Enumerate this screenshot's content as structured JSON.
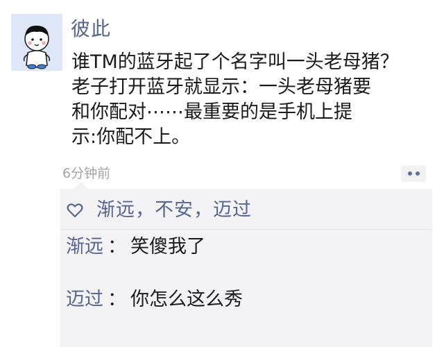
{
  "post": {
    "author": "彼此",
    "content_lines": [
      "谁TM的蓝牙起了个名字叫一头老母猪？",
      "老子打开蓝牙就显示：一头老母猪要",
      "和你配对⋯⋯最重要的是手机上提",
      "示:你配不上。"
    ],
    "time": "6分钟前"
  },
  "interaction": {
    "likes": "渐远，不安，迈过",
    "comments": [
      {
        "name": "渐远",
        "colon": "：",
        "text": "笑傻我了"
      },
      {
        "name": "迈过",
        "colon": "：",
        "text": "你怎么这么秀"
      }
    ]
  },
  "icons": {
    "avatar": "cartoon-boy-avatar",
    "more": "more-dots-icon",
    "like": "heart-outline-icon"
  },
  "colors": {
    "name": "#55668f",
    "time": "#a3a3a3",
    "panel": "#f3f3f5",
    "avatar_bg": "#dde7f7"
  }
}
